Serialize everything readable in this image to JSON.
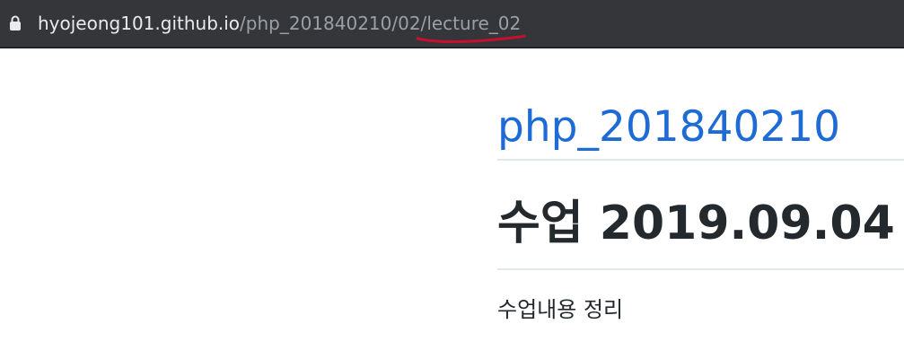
{
  "browser": {
    "url_host": "hyojeong101.github.io",
    "url_path_1": "/php_201840210/02/",
    "url_path_2": "lecture_02",
    "lock_icon": "lock-icon",
    "annotation_color": "#c8102e"
  },
  "page": {
    "site_title": "php_201840210",
    "heading": "수업 2019.09.04",
    "body": "수업내용 정리"
  },
  "colors": {
    "link": "#1e6bd6",
    "text": "#24292e",
    "toolbar": "#35363a"
  }
}
